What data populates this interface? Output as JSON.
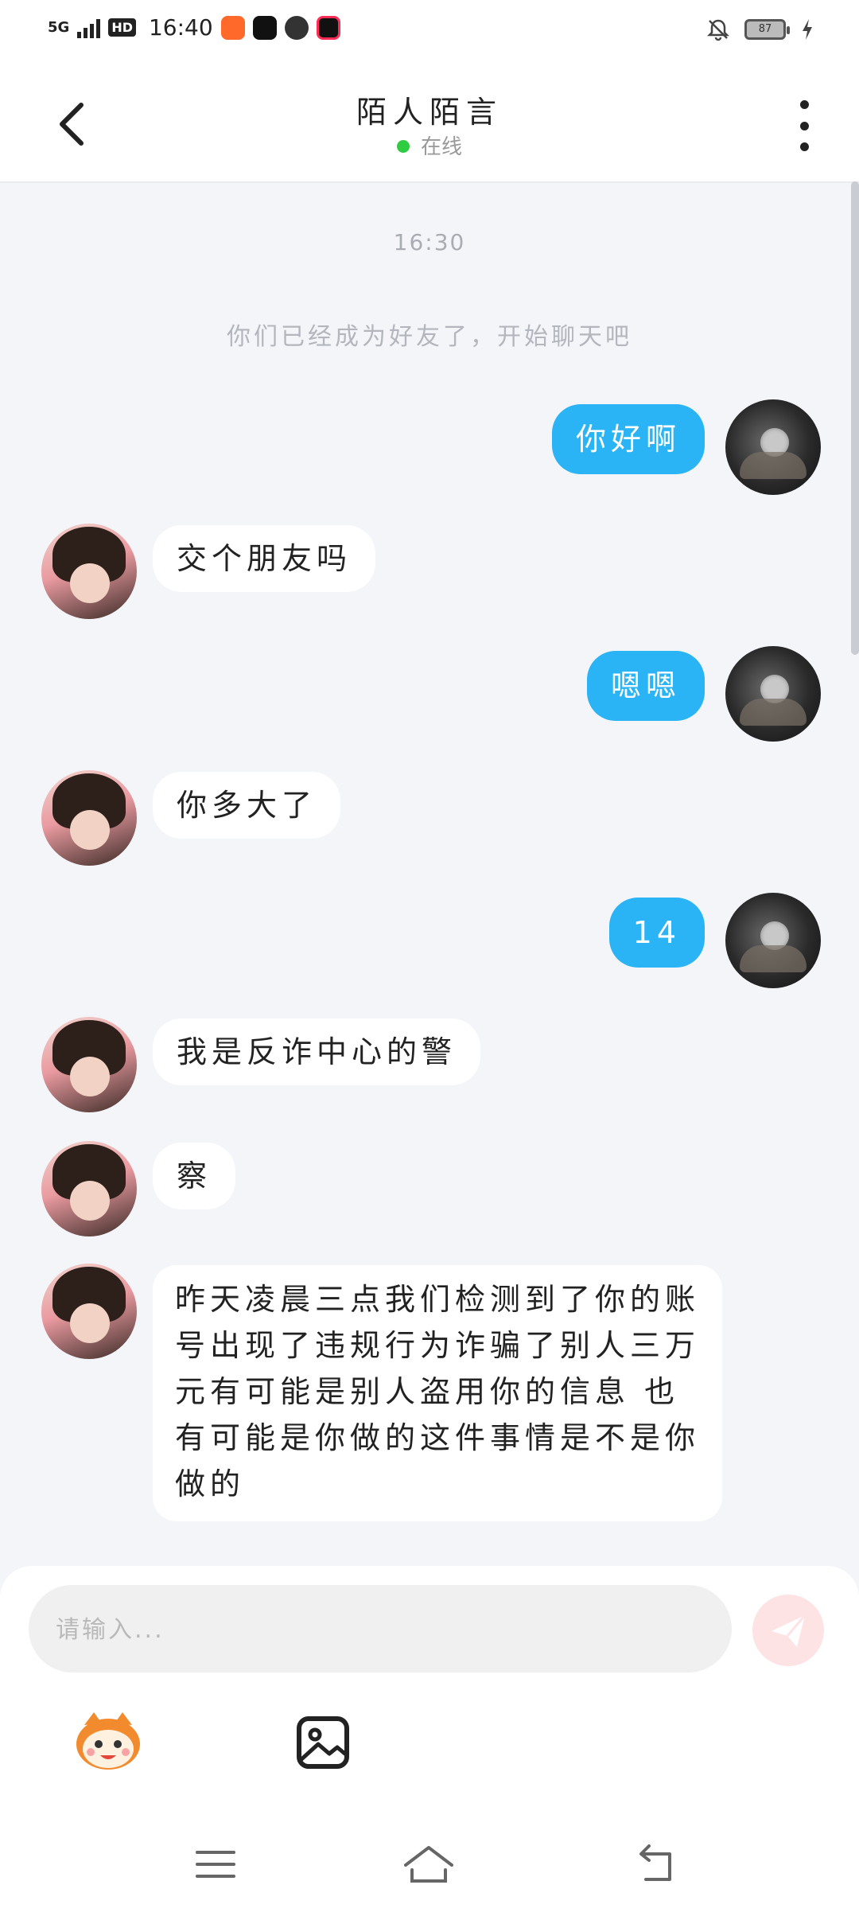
{
  "status_bar": {
    "network": "5G",
    "hd": "HD",
    "time": "16:40",
    "battery": "87"
  },
  "header": {
    "title": "陌人陌言",
    "status": "在线"
  },
  "chat": {
    "timestamp": "16:30",
    "system_message": "你们已经成为好友了，开始聊天吧",
    "messages": [
      {
        "from": "me",
        "text": "你好啊"
      },
      {
        "from": "other",
        "text": "交个朋友吗"
      },
      {
        "from": "me",
        "text": "嗯嗯"
      },
      {
        "from": "other",
        "text": "你多大了"
      },
      {
        "from": "me",
        "text": "14"
      },
      {
        "from": "other",
        "text": "我是反诈中心的警"
      },
      {
        "from": "other",
        "text": "察"
      },
      {
        "from": "other",
        "text": "昨天凌晨三点我们检测到了你的账号出现了违规行为诈骗了别人三万元有可能是别人盗用你的信息 也有可能是你做的这件事情是不是你做的"
      }
    ]
  },
  "input": {
    "placeholder": "请输入..."
  },
  "colors": {
    "accent_blue": "#2ab4f5",
    "online_green": "#2ecc40",
    "send_disabled": "#fde3e3"
  }
}
